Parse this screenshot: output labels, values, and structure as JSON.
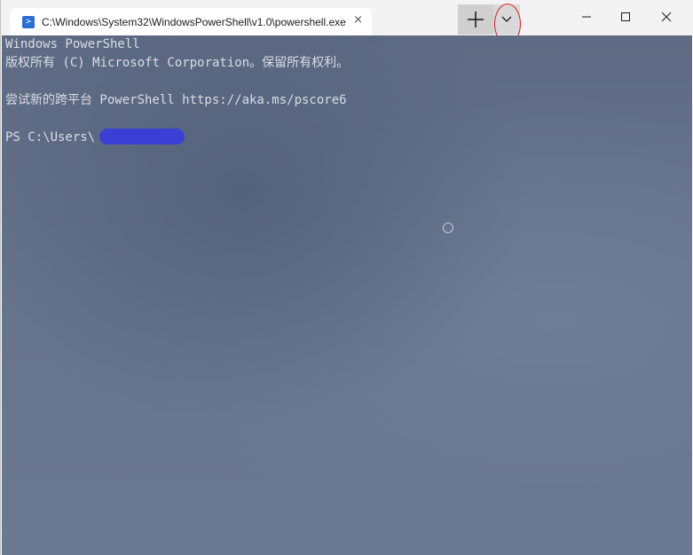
{
  "tab": {
    "title": "C:\\Windows\\System32\\WindowsPowerShell\\v1.0\\powershell.exe",
    "icon": "powershell-icon",
    "close_glyph": "×"
  },
  "toolbar": {
    "new_tab_icon": "plus-icon",
    "dropdown_icon": "chevron-down-icon"
  },
  "window_controls": {
    "minimize_icon": "minimize-icon",
    "maximize_icon": "maximize-icon",
    "close_icon": "close-icon"
  },
  "terminal": {
    "lines": [
      "Windows PowerShell",
      "版权所有 (C) Microsoft Corporation。保留所有权利。",
      "",
      "尝试新的跨平台 PowerShell https://aka.ms/pscore6",
      "",
      "PS C:\\Users\\"
    ]
  },
  "colors": {
    "terminal_bg": "#66738d",
    "terminal_text": "#d9dde5",
    "annotation": "#e01616",
    "redaction": "#3b3fd6"
  }
}
